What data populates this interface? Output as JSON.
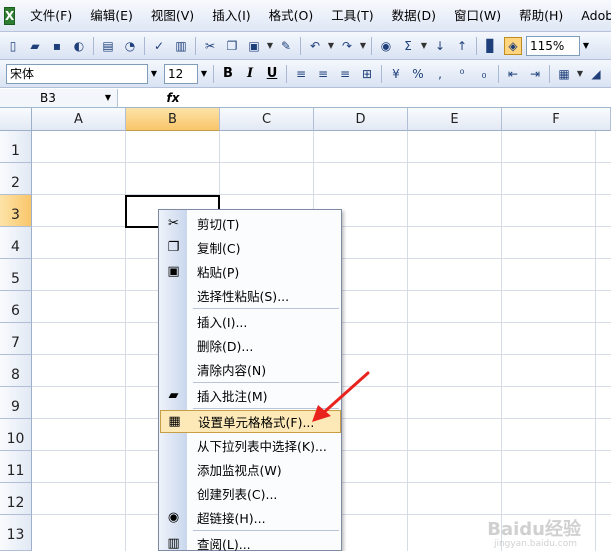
{
  "menu": {
    "items": [
      "文件(F)",
      "编辑(E)",
      "视图(V)",
      "插入(I)",
      "格式(O)",
      "工具(T)",
      "数据(D)",
      "窗口(W)",
      "帮助(H)",
      "Adobe PDF(B)"
    ]
  },
  "toolbar": {
    "zoom": "115%"
  },
  "format_toolbar": {
    "font": "宋体",
    "size": "12",
    "bold": "B",
    "italic": "I",
    "underline": "U"
  },
  "formula_bar": {
    "name_box": "B3",
    "fx": "fx"
  },
  "grid": {
    "columns": [
      "A",
      "B",
      "C",
      "D",
      "E",
      "F"
    ],
    "rows": [
      "1",
      "2",
      "3",
      "4",
      "5",
      "6",
      "7",
      "8",
      "9",
      "10",
      "11",
      "12",
      "13"
    ]
  },
  "context_menu": {
    "items": [
      "剪切(T)",
      "复制(C)",
      "粘贴(P)",
      "选择性粘贴(S)...",
      "插入(I)...",
      "删除(D)...",
      "清除内容(N)",
      "插入批注(M)",
      "设置单元格格式(F)...",
      "从下拉列表中选择(K)...",
      "添加监视点(W)",
      "创建列表(C)...",
      "超链接(H)...",
      "查阅(L)..."
    ]
  },
  "watermark": {
    "text": "Baidu经验",
    "sub": "jingyan.baidu.com"
  },
  "colors": {
    "highlight": "#fde9b8",
    "selected_header": "#f9c66a",
    "arrow": "#e8231e"
  }
}
